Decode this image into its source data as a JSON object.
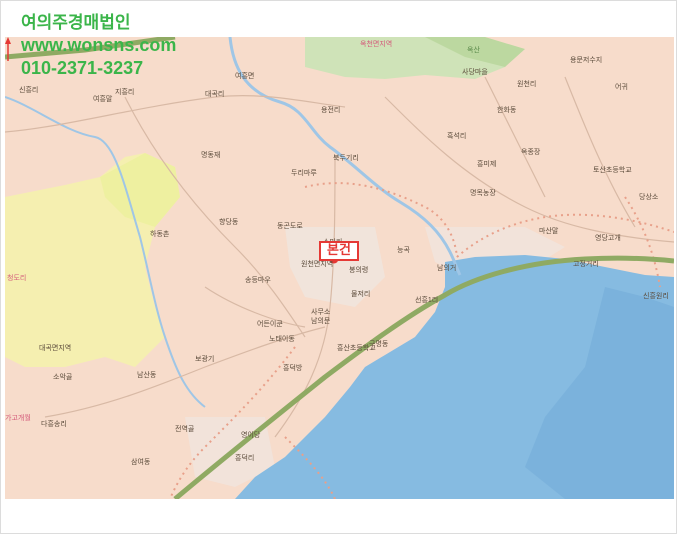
{
  "overlay": {
    "company": "여의주경매법인",
    "website": "www.wonsns.com",
    "phone": "010-2371-3237"
  },
  "marker": {
    "label": "본건",
    "color": "#e53935"
  },
  "map_labels": [
    {
      "text": "옥천면지역",
      "style": "pink",
      "key": "l1"
    },
    {
      "text": "신흥리",
      "style": "",
      "key": "l2"
    },
    {
      "text": "여흥말",
      "style": "",
      "key": "l3"
    },
    {
      "text": "지흥리",
      "style": "",
      "key": "l4"
    },
    {
      "text": "여흥면",
      "style": "",
      "key": "l5"
    },
    {
      "text": "대곡리",
      "style": "",
      "key": "l6"
    },
    {
      "text": "옥산",
      "style": "",
      "key": "l7"
    },
    {
      "text": "용문저수지",
      "style": "",
      "key": "l8"
    },
    {
      "text": "사당마을",
      "style": "",
      "key": "l9"
    },
    {
      "text": "원천리",
      "style": "",
      "key": "l10"
    },
    {
      "text": "어귀",
      "style": "",
      "key": "l11"
    },
    {
      "text": "용전리",
      "style": "",
      "key": "l12"
    },
    {
      "text": "한화동",
      "style": "",
      "key": "l13"
    },
    {
      "text": "흑석리",
      "style": "",
      "key": "l14"
    },
    {
      "text": "북두기리",
      "style": "",
      "key": "l15"
    },
    {
      "text": "명동재",
      "style": "",
      "key": "l16"
    },
    {
      "text": "옥종장",
      "style": "",
      "key": "l17"
    },
    {
      "text": "흥미제",
      "style": "",
      "key": "l18"
    },
    {
      "text": "토산초등학교",
      "style": "",
      "key": "l19"
    },
    {
      "text": "명목농장",
      "style": "",
      "key": "l20"
    },
    {
      "text": "두리마루",
      "style": "",
      "key": "l21"
    },
    {
      "text": "당상소",
      "style": "",
      "key": "l22"
    },
    {
      "text": "향당동",
      "style": "",
      "key": "l23"
    },
    {
      "text": "동곤도로",
      "style": "",
      "key": "l24"
    },
    {
      "text": "소미리",
      "style": "",
      "key": "l25"
    },
    {
      "text": "능곡",
      "style": "",
      "key": "l26"
    },
    {
      "text": "마산말",
      "style": "",
      "key": "l27"
    },
    {
      "text": "영당고개",
      "style": "",
      "key": "l28"
    },
    {
      "text": "하동촌",
      "style": "",
      "key": "l29"
    },
    {
      "text": "원천면지역",
      "style": "pink",
      "key": "l30"
    },
    {
      "text": "청도리",
      "style": "",
      "key": "l31"
    },
    {
      "text": "송등마우",
      "style": "",
      "key": "l32"
    },
    {
      "text": "봉의령",
      "style": "",
      "key": "l33"
    },
    {
      "text": "남의거",
      "style": "",
      "key": "l34"
    },
    {
      "text": "고정거리",
      "style": "",
      "key": "l35"
    },
    {
      "text": "물저리",
      "style": "",
      "key": "l36"
    },
    {
      "text": "선흥1리",
      "style": "",
      "key": "l37"
    },
    {
      "text": "사무소",
      "style": "",
      "key": "l38"
    },
    {
      "text": "남의문",
      "style": "",
      "key": "l39"
    },
    {
      "text": "신흥원리",
      "style": "",
      "key": "l40"
    },
    {
      "text": "어든이쿤",
      "style": "",
      "key": "l41"
    },
    {
      "text": "노태이동",
      "style": "",
      "key": "l42"
    },
    {
      "text": "보광기",
      "style": "",
      "key": "l43"
    },
    {
      "text": "구명동",
      "style": "",
      "key": "l44"
    },
    {
      "text": "흥산초등학교",
      "style": "",
      "key": "l45"
    },
    {
      "text": "흥덕방",
      "style": "",
      "key": "l46"
    },
    {
      "text": "소악골",
      "style": "",
      "key": "l47"
    },
    {
      "text": "남산동",
      "style": "",
      "key": "l48"
    },
    {
      "text": "대곡면지역",
      "style": "pink",
      "key": "l49"
    },
    {
      "text": "가고개월",
      "style": "",
      "key": "l50"
    },
    {
      "text": "다흥송리",
      "style": "",
      "key": "l51"
    },
    {
      "text": "전역골",
      "style": "",
      "key": "l52"
    },
    {
      "text": "영이당",
      "style": "",
      "key": "l53"
    },
    {
      "text": "삼여동",
      "style": "",
      "key": "l54"
    },
    {
      "text": "흥덕리",
      "style": "",
      "key": "l55"
    }
  ]
}
